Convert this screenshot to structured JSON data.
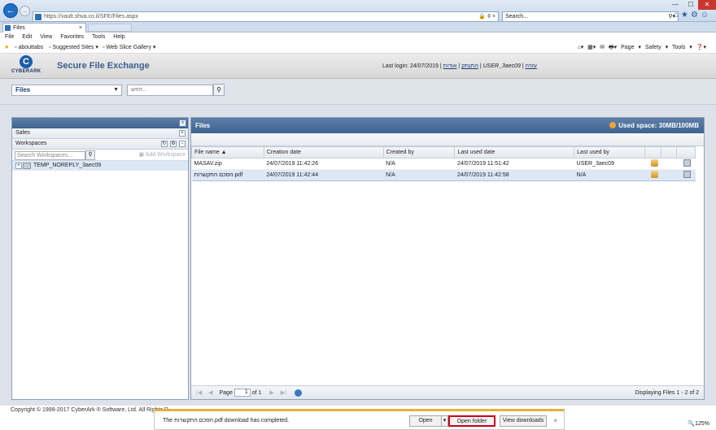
{
  "browser": {
    "url": "https://vault.shva.co.il/SFE/Files.aspx",
    "url_actions": "🔒 ¢ ×",
    "search_placeholder": "Search...",
    "tab_title": "Files",
    "window_min": "—",
    "window_max": "☐",
    "window_close": "✕",
    "menu": [
      "File",
      "Edit",
      "View",
      "Favorites",
      "Tools",
      "Help"
    ],
    "favorites": [
      "abouttabs",
      "Suggested Sites ▾",
      "Web Slice Gallery ▾"
    ],
    "ie_tools": "Page ▾ Safety ▾ Tools ▾"
  },
  "app": {
    "brand": "CYBERARK",
    "title": "Secure File Exchange",
    "last_login": "Last login: 24/07/2019 |",
    "header_links": [
      "התנתק",
      "אודות",
      "USER_3aec09",
      "עזרה"
    ]
  },
  "filter": {
    "dropdown_value": "Files",
    "search_placeholder": "חפש..."
  },
  "left_panel": {
    "safes_label": "Safes",
    "workspaces_label": "Workspaces",
    "search_placeholder": "Search Workspaces...",
    "add_workspace": "Add Workspace",
    "workspace_item": "TEMP_NOREPLY_3aec09"
  },
  "right_panel": {
    "title": "Files",
    "used_space": "Used space: 30MB/100MB",
    "columns": [
      "File name ▲",
      "Creation date",
      "Created by",
      "Last used date",
      "Last used by"
    ],
    "rows": [
      {
        "name": "MASAV.zip",
        "created": "24/07/2019 11:42:26",
        "created_by": "N/A",
        "last_used": "24/07/2019 11:51:42",
        "last_used_by": "USER_3aec09"
      },
      {
        "name": "הסכם התקשרות.pdf",
        "created": "24/07/2019 11:42:44",
        "created_by": "N/A",
        "last_used": "24/07/2019 11:42:58",
        "last_used_by": "N/A"
      }
    ],
    "pager": {
      "page_label": "Page",
      "page_value": "1",
      "of_label": "of 1",
      "info": "Displaying Files 1 - 2 of 2"
    }
  },
  "footer": {
    "copyright": "Copyright © 1999-2017 CyberArk ® Software, Ltd. All Rights R"
  },
  "notification": {
    "message": "The הסכם התקשרות.pdf download has completed.",
    "open": "Open",
    "open_folder": "Open folder",
    "view_downloads": "View downloads",
    "zoom": "🔍125%"
  }
}
